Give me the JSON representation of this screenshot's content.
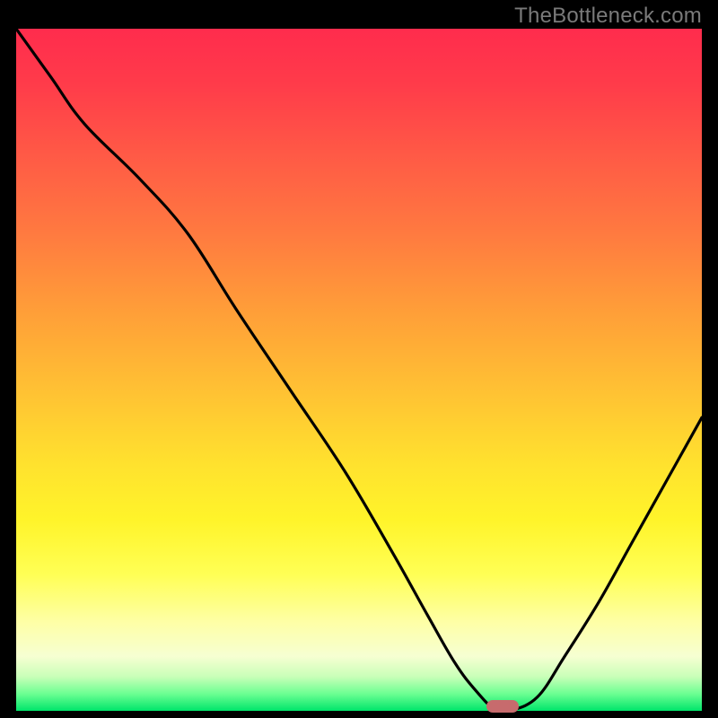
{
  "watermark": "TheBottleneck.com",
  "colors": {
    "frame_bg": "#000000",
    "curve": "#000000",
    "marker": "#c76b6d",
    "watermark": "#7a7a7a"
  },
  "chart_data": {
    "type": "line",
    "title": "",
    "xlabel": "",
    "ylabel": "",
    "xlim": [
      0,
      100
    ],
    "ylim": [
      0,
      100
    ],
    "grid": false,
    "legend": false,
    "series": [
      {
        "name": "bottleneck-curve",
        "x": [
          0,
          5,
          10,
          18,
          25,
          32,
          40,
          48,
          55,
          60,
          64,
          67,
          70,
          72,
          76,
          80,
          85,
          90,
          95,
          100
        ],
        "values": [
          100,
          93,
          86,
          78,
          70,
          59,
          47,
          35,
          23,
          14,
          7,
          3,
          0,
          0,
          2,
          8,
          16,
          25,
          34,
          43
        ]
      }
    ],
    "marker": {
      "x": 71,
      "y": 0,
      "width_pct": 4.7,
      "height_pct": 1.8
    },
    "gradient_stops": [
      {
        "pct": 0,
        "color": "#ff2c4d"
      },
      {
        "pct": 8,
        "color": "#ff3b4a"
      },
      {
        "pct": 18,
        "color": "#ff5846"
      },
      {
        "pct": 30,
        "color": "#ff7a40"
      },
      {
        "pct": 42,
        "color": "#ffa038"
      },
      {
        "pct": 54,
        "color": "#ffc433"
      },
      {
        "pct": 64,
        "color": "#ffe22e"
      },
      {
        "pct": 72,
        "color": "#fff42a"
      },
      {
        "pct": 80,
        "color": "#ffff55"
      },
      {
        "pct": 87,
        "color": "#feffa6"
      },
      {
        "pct": 92,
        "color": "#f6ffd2"
      },
      {
        "pct": 95,
        "color": "#c9ffb8"
      },
      {
        "pct": 97.5,
        "color": "#6cff92"
      },
      {
        "pct": 100,
        "color": "#00e56b"
      }
    ]
  }
}
